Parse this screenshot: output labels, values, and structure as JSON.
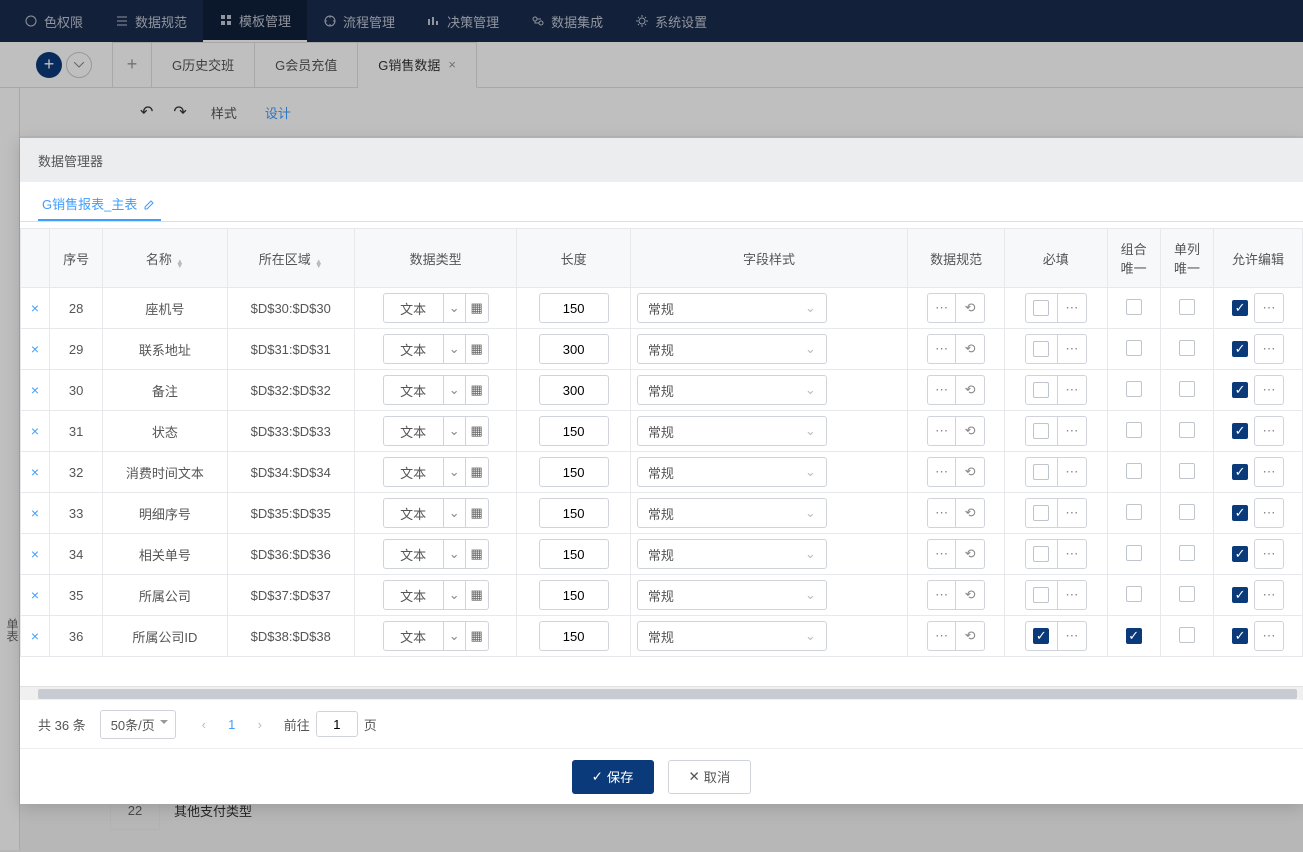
{
  "nav": [
    {
      "label": "色权限"
    },
    {
      "label": "数据规范"
    },
    {
      "label": "模板管理",
      "active": true
    },
    {
      "label": "流程管理"
    },
    {
      "label": "决策管理"
    },
    {
      "label": "数据集成"
    },
    {
      "label": "系统设置"
    }
  ],
  "tabs": [
    {
      "label": "G历史交班"
    },
    {
      "label": "G会员充值"
    },
    {
      "label": "G销售数据",
      "active": true,
      "closable": true
    }
  ],
  "toolbar": {
    "style": "样式",
    "design": "设计"
  },
  "sidebar": {
    "text": "单表"
  },
  "bgRow": {
    "num": "22",
    "text": "其他支付类型"
  },
  "dialog": {
    "title": "数据管理器",
    "tab": "G销售报表_主表",
    "columns": [
      "",
      "序号",
      "名称",
      "所在区域",
      "数据类型",
      "长度",
      "字段样式",
      "数据规范",
      "必填",
      "组合唯一",
      "单列唯一",
      "允许编辑"
    ],
    "rows": [
      {
        "n": "28",
        "name": "座机号",
        "area": "$D$30:$D$30",
        "type": "文本",
        "len": "150",
        "style": "常规",
        "req": false,
        "cu": false,
        "su": false,
        "ed": true
      },
      {
        "n": "29",
        "name": "联系地址",
        "area": "$D$31:$D$31",
        "type": "文本",
        "len": "300",
        "style": "常规",
        "req": false,
        "cu": false,
        "su": false,
        "ed": true
      },
      {
        "n": "30",
        "name": "备注",
        "area": "$D$32:$D$32",
        "type": "文本",
        "len": "300",
        "style": "常规",
        "req": false,
        "cu": false,
        "su": false,
        "ed": true
      },
      {
        "n": "31",
        "name": "状态",
        "area": "$D$33:$D$33",
        "type": "文本",
        "len": "150",
        "style": "常规",
        "req": false,
        "cu": false,
        "su": false,
        "ed": true
      },
      {
        "n": "32",
        "name": "消费时间文本",
        "area": "$D$34:$D$34",
        "type": "文本",
        "len": "150",
        "style": "常规",
        "req": false,
        "cu": false,
        "su": false,
        "ed": true
      },
      {
        "n": "33",
        "name": "明细序号",
        "area": "$D$35:$D$35",
        "type": "文本",
        "len": "150",
        "style": "常规",
        "req": false,
        "cu": false,
        "su": false,
        "ed": true
      },
      {
        "n": "34",
        "name": "相关单号",
        "area": "$D$36:$D$36",
        "type": "文本",
        "len": "150",
        "style": "常规",
        "req": false,
        "cu": false,
        "su": false,
        "ed": true
      },
      {
        "n": "35",
        "name": "所属公司",
        "area": "$D$37:$D$37",
        "type": "文本",
        "len": "150",
        "style": "常规",
        "req": false,
        "cu": false,
        "su": false,
        "ed": true
      },
      {
        "n": "36",
        "name": "所属公司ID",
        "area": "$D$38:$D$38",
        "type": "文本",
        "len": "150",
        "style": "常规",
        "req": true,
        "cu": true,
        "su": false,
        "ed": true
      }
    ],
    "pager": {
      "total": "共 36 条",
      "size": "50条/页",
      "page": "1",
      "goto": "前往",
      "gotoVal": "1",
      "pageUnit": "页"
    },
    "save": "保存",
    "cancel": "取消"
  }
}
